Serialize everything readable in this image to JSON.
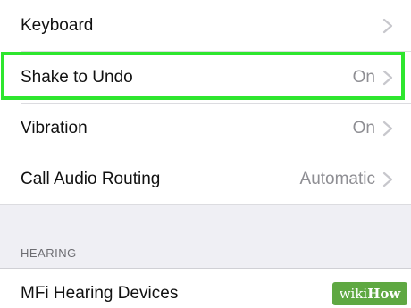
{
  "settings": {
    "rows": [
      {
        "label": "Keyboard",
        "value": ""
      },
      {
        "label": "Shake to Undo",
        "value": "On"
      },
      {
        "label": "Vibration",
        "value": "On"
      },
      {
        "label": "Call Audio Routing",
        "value": "Automatic"
      }
    ],
    "hearing_section": {
      "header": "HEARING",
      "rows": [
        {
          "label": "MFi Hearing Devices"
        }
      ]
    }
  },
  "highlight_color": "#2ee62e",
  "watermark": {
    "wiki": "wiki",
    "how": "How",
    "color": "#5fa842"
  },
  "icons": {
    "row_disclosure": "chevron-right-icon"
  }
}
